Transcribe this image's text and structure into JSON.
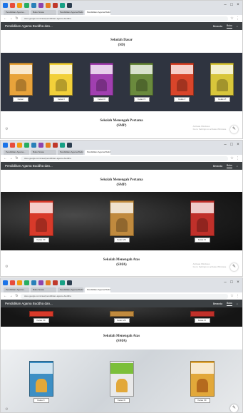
{
  "site_title": "Pendidikan Agama Buddha dan...",
  "nav": {
    "beranda": "Beranda",
    "buku": "Buku",
    "search_icon": "search-icon"
  },
  "browser": {
    "url": "sites.google.com/view/pendidikan-agama-buddha",
    "tab_labels": [
      "Pendidikan Agama...",
      "Buku Siswa",
      "Pendidikan Agama Buddha",
      "Pendidikan Agama Buddha"
    ]
  },
  "screens": [
    {
      "sections": [
        {
          "title": "Sekolah Dasar",
          "subtitle": "(SD)"
        },
        {
          "title": "Sekolah Menengah Pertama",
          "subtitle": "(SMP)"
        }
      ],
      "books": [
        {
          "label": "Kelas I",
          "color": "#e8a33b"
        },
        {
          "label": "Kelas II",
          "color": "#f2d03a"
        },
        {
          "label": "Kelas III",
          "color": "#a13fb0"
        },
        {
          "label": "Kelas IV",
          "color": "#6a8a3d"
        },
        {
          "label": "Kelas V",
          "color": "#d9452a"
        },
        {
          "label": "Kelas VI",
          "color": "#d8c63b"
        }
      ]
    },
    {
      "sections": [
        {
          "title": "Sekolah Menengah Pertama",
          "subtitle": "(SMP)"
        },
        {
          "title": "Sekolah Menengah Atas",
          "subtitle": "(SMA)"
        }
      ],
      "books": [
        {
          "label": "Kelas VII",
          "color": "#d83a2a"
        },
        {
          "label": "Kelas VIII",
          "color": "#c08a3e"
        },
        {
          "label": "Kelas IX",
          "color": "#c0302a"
        }
      ]
    },
    {
      "sections": [
        {
          "title": "Sekolah Menengah Atas",
          "subtitle": "(SMA)"
        }
      ],
      "top_books": [
        {
          "label": "Kelas VII"
        },
        {
          "label": "Kelas VIII"
        },
        {
          "label": "Kelas IX"
        }
      ],
      "books": [
        {
          "label": "Kelas X",
          "color": "#3d8fc4"
        },
        {
          "label": "Kelas XI",
          "color": "#e9e9e9"
        },
        {
          "label": "Kelas XII",
          "color": "#e2a83a"
        }
      ]
    }
  ],
  "watermark": [
    "Activate Windows",
    "Go to Settings to activate Windows."
  ],
  "fab_icon": "edit-icon",
  "colors": {
    "header": "#3c4043",
    "band1": "#2f3440",
    "band2": "#1c1c1c",
    "band3": "#d9dde1"
  }
}
